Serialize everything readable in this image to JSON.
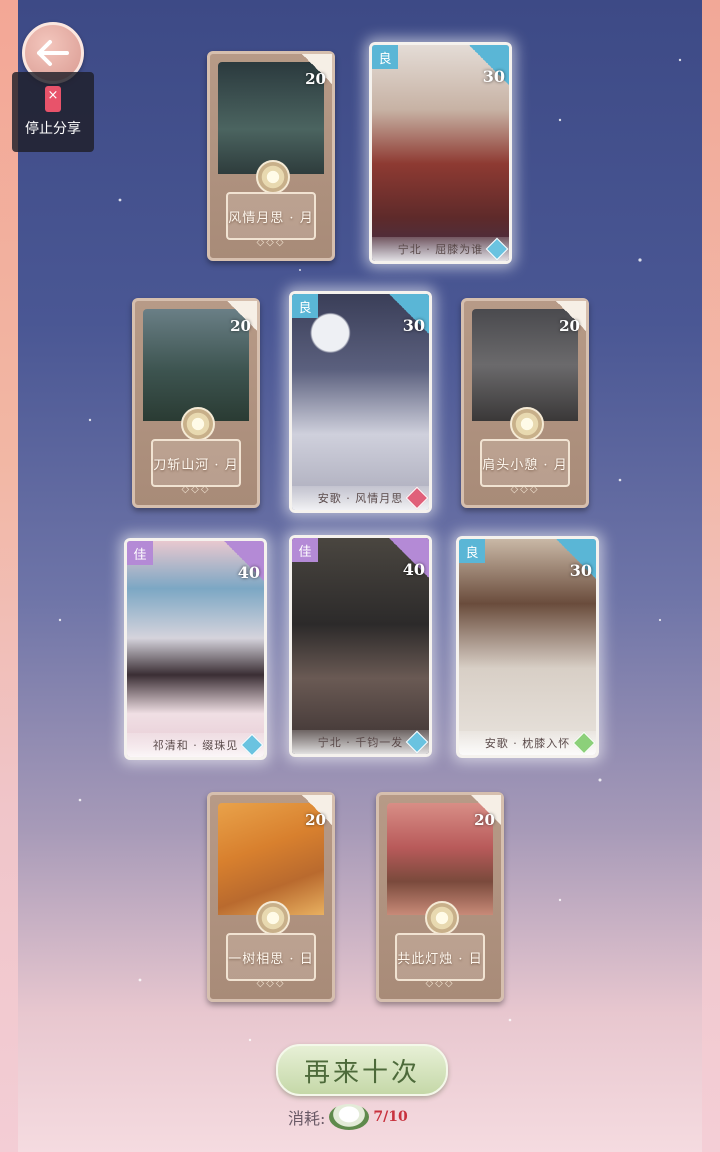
{
  "share": {
    "label": "停止分享"
  },
  "cards": [
    {
      "id": "c1",
      "type": "standard",
      "name": "风情月思 · 月",
      "power": "20"
    },
    {
      "id": "c2",
      "type": "hero",
      "rank": "良",
      "rank_color": "blue",
      "power": "30",
      "name": "宁北 · 屈膝为谁"
    },
    {
      "id": "c3",
      "type": "standard",
      "name": "刀斩山河 · 月",
      "power": "20"
    },
    {
      "id": "c4",
      "type": "hero",
      "rank": "良",
      "rank_color": "blue",
      "power": "30",
      "name": "安歌 · 风情月思"
    },
    {
      "id": "c5",
      "type": "standard",
      "name": "肩头小憩 · 月",
      "power": "20"
    },
    {
      "id": "c6",
      "type": "hero",
      "rank": "佳",
      "rank_color": "purple",
      "power": "40",
      "name": "祁清和 · 缀珠见"
    },
    {
      "id": "c7",
      "type": "hero",
      "rank": "佳",
      "rank_color": "purple",
      "power": "40",
      "name": "宁北 · 千钧一发"
    },
    {
      "id": "c8",
      "type": "hero",
      "rank": "良",
      "rank_color": "blue",
      "power": "30",
      "name": "安歌 · 枕膝入怀"
    },
    {
      "id": "c9",
      "type": "standard",
      "name": "一树相思 · 日",
      "power": "20"
    },
    {
      "id": "c10",
      "type": "standard",
      "name": "共此灯烛 · 日",
      "power": "20"
    }
  ],
  "actions": {
    "retry_label": "再来十次"
  },
  "cost": {
    "label": "消耗:",
    "amount": "7/10"
  },
  "colors": {
    "blue_rank": "#5ab6d6",
    "purple_rank": "#b48ad6",
    "retry_text": "#4d6a3a"
  }
}
